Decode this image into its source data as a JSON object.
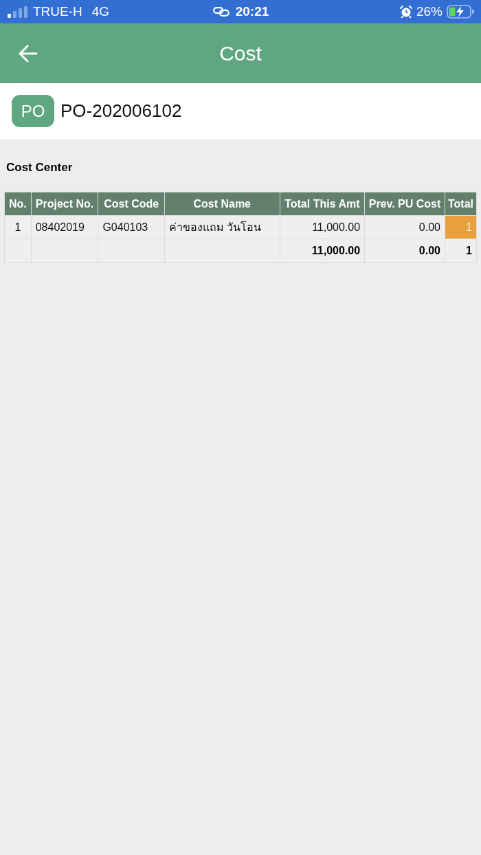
{
  "status_bar": {
    "carrier": "TRUE-H",
    "network": "4G",
    "time": "20:21",
    "battery": "26%"
  },
  "header": {
    "title": "Cost"
  },
  "document": {
    "badge": "PO",
    "number": "PO-202006102"
  },
  "section": {
    "title": "Cost Center"
  },
  "table": {
    "columns": [
      "No.",
      "Project No.",
      "Cost Code",
      "Cost Name",
      "Total This Amt",
      "Prev. PU Cost",
      "Total"
    ],
    "rows": [
      {
        "cells": [
          "1",
          "08402019",
          "G040103",
          "ค่าของแถม วันโอน",
          "11,000.00",
          "0.00",
          "1"
        ],
        "color": "#e9a03c"
      }
    ],
    "totals": [
      "11,000.00",
      "0.00",
      "1"
    ]
  }
}
